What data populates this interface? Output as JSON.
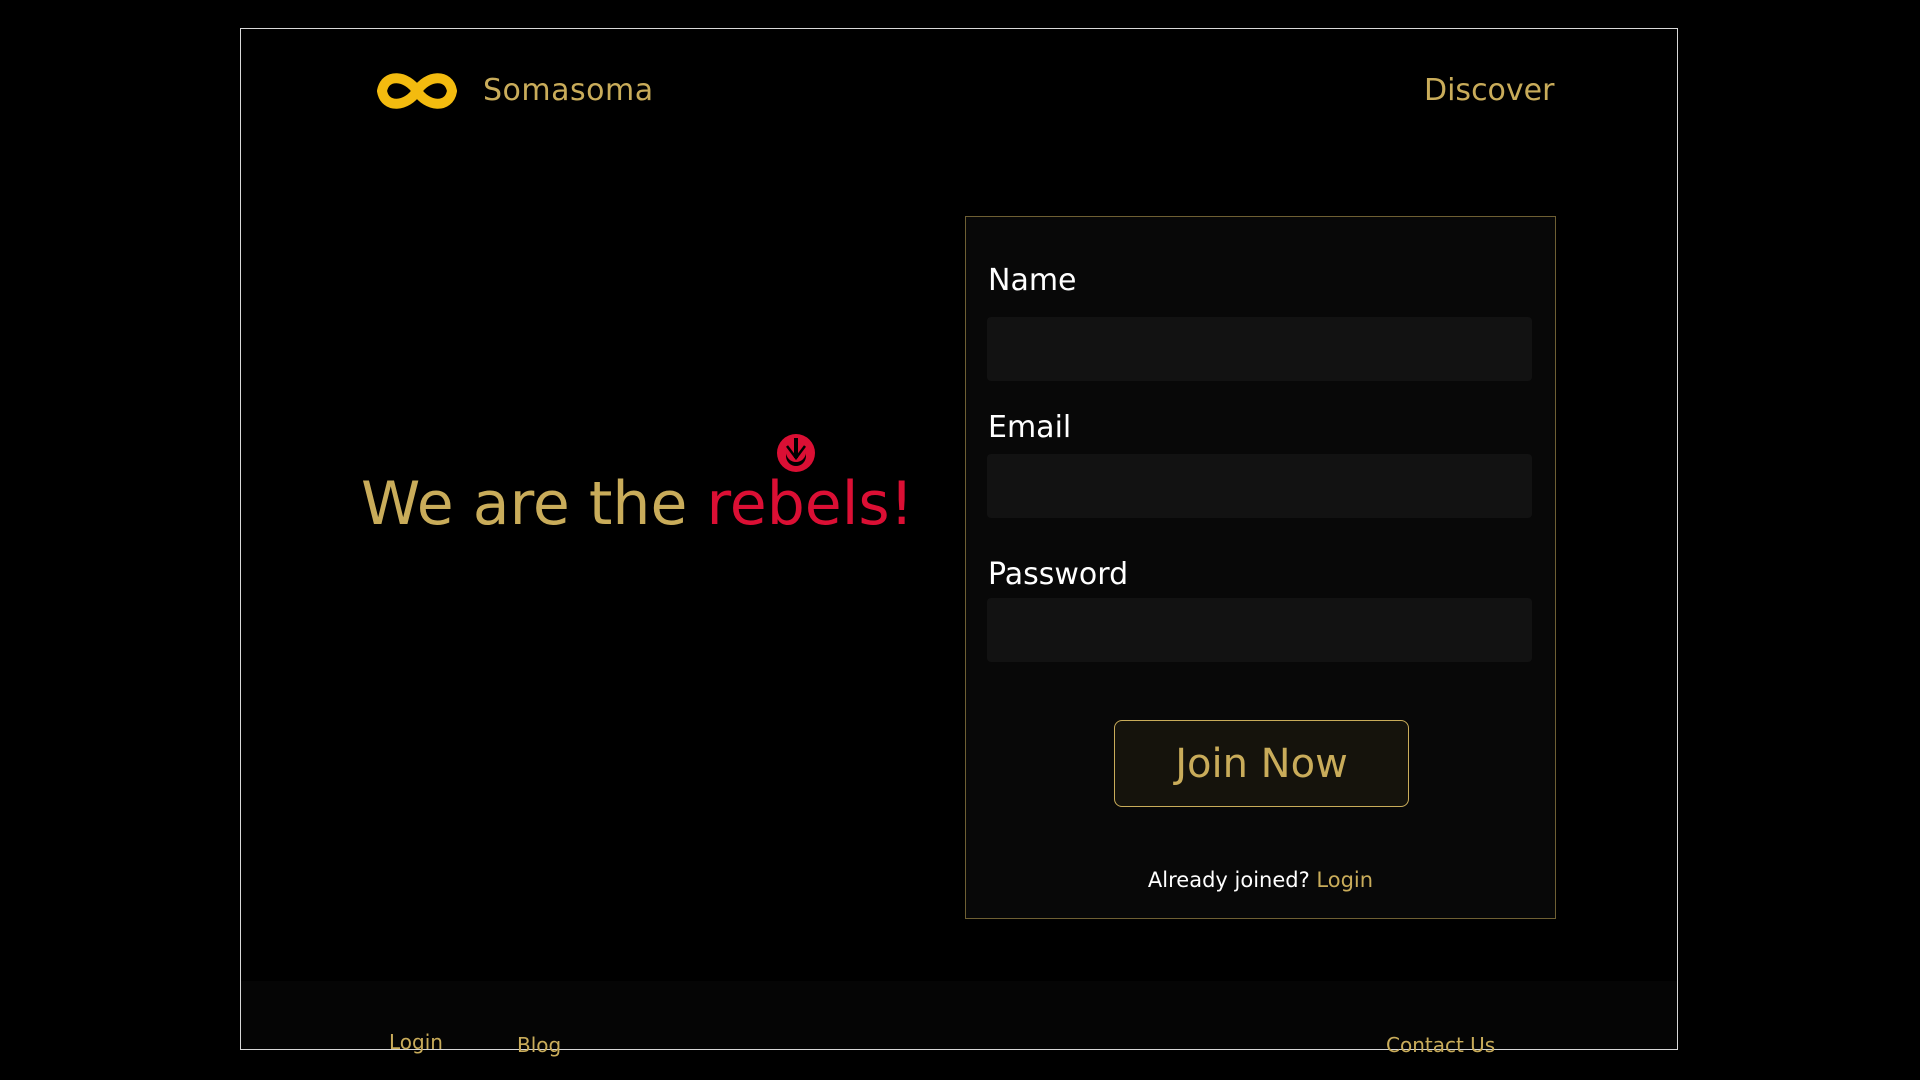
{
  "header": {
    "brand": "Somasoma",
    "nav_discover": "Discover"
  },
  "hero": {
    "text_main": "We are the ",
    "text_accent": "rebels!"
  },
  "form": {
    "name_label": "Name",
    "email_label": "Email",
    "password_label": "Password",
    "name_value": "",
    "email_value": "",
    "password_value": "",
    "submit_label": "Join Now",
    "already_text": "Already joined? ",
    "login_link": "Login"
  },
  "footer": {
    "login": "Login",
    "blog": "Blog",
    "contact": "Contact Us"
  },
  "icons": {
    "logo": "infinity-logo-icon",
    "hero_emblem": "rebel-alliance-icon"
  },
  "colors": {
    "background": "#000000",
    "gold": "#c9ac5a",
    "logo_yellow": "#f3bb0f",
    "accent_red": "#db0f34",
    "input_bg": "#121212",
    "card_border": "#6e5f33"
  }
}
